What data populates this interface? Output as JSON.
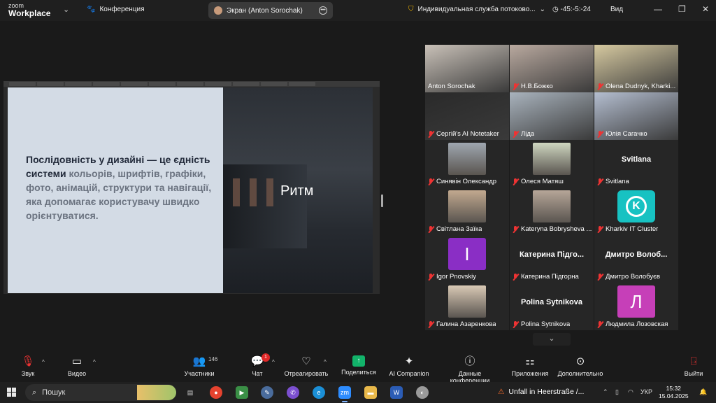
{
  "titlebar": {
    "logo_top": "zoom",
    "logo_bottom": "Workplace",
    "meeting_label": "Конференция",
    "share_label": "Экран (Anton Sorochak)",
    "service_label": "Индивидуальная служба потоково...",
    "timer": "-45:-5:-24",
    "view_label": "Вид"
  },
  "slide": {
    "text_bold": "Послідовність у дизайні — це єдність системи ",
    "text_grey": "кольорів, шрифтів, графіки, фото, анімацій, структури та навігації, яка допомагає користувачу швидко орієнтуватися.",
    "title": "Ритм"
  },
  "participants": [
    {
      "name": "Anton Sorochak",
      "type": "video",
      "color": "#c9c1b8"
    },
    {
      "name": "Н.В.Божко",
      "type": "video",
      "color": "#b9a99f"
    },
    {
      "name": "Olena Dudnyk, Kharki...",
      "type": "video",
      "color": "#d6c9a0"
    },
    {
      "name": "Сергій's AI Notetaker",
      "type": "video",
      "color": "#2a2a2a"
    },
    {
      "name": "Ліда",
      "type": "video",
      "color": "#a9b3bd"
    },
    {
      "name": "Юлія Сагачко",
      "type": "video",
      "color": "#b4bed0"
    },
    {
      "name": "Синявін Олександр",
      "type": "avatar",
      "color": "#9fa7b0"
    },
    {
      "name": "Олеся Матяш",
      "type": "avatar",
      "color": "#cfd7c0"
    },
    {
      "name": "Svitlana",
      "type": "text",
      "big": "Svitlana"
    },
    {
      "name": "Світлана Заїка",
      "type": "avatar",
      "color": "#c2a98f"
    },
    {
      "name": "Kateryna Bobrysheva ...",
      "type": "avatar",
      "color": "#b6a698"
    },
    {
      "name": "Kharkiv IT Cluster",
      "type": "logo",
      "letter": "K"
    },
    {
      "name": "Igor Pnovskiy",
      "type": "letter",
      "letter": "I"
    },
    {
      "name": "Катерина Підгорна",
      "type": "text",
      "big": "Катерина  Підго..."
    },
    {
      "name": "Дмитро Волобуєв",
      "type": "text",
      "big": "Дмитро  Волоб..."
    },
    {
      "name": "Галина Азаренкова",
      "type": "avatar",
      "color": "#d9c9b5"
    },
    {
      "name": "Polina Sytnikova",
      "type": "text",
      "big": "Polina Sytnikova"
    },
    {
      "name": "Людмила Лозовская",
      "type": "letter",
      "letter": "Л"
    }
  ],
  "toolbar": {
    "audio": "Звук",
    "video": "Видео",
    "participants": "Участники",
    "participants_count": "146",
    "chat": "Чат",
    "chat_badge": "1",
    "react": "Отреагировать",
    "share": "Поделиться",
    "ai": "AI Companion",
    "info": "Данные конференции",
    "apps": "Приложения",
    "more": "Дополнительно",
    "leave": "Выйти"
  },
  "taskbar": {
    "search": "Пошук",
    "notification": "Unfall in Heerstraße /...",
    "lang": "УКР",
    "time": "15:32",
    "date": "15.04.2025"
  },
  "colors": {
    "accent_green": "#12b36a",
    "active_speaker": "#3fbf6f",
    "mute_red": "#e33333"
  }
}
